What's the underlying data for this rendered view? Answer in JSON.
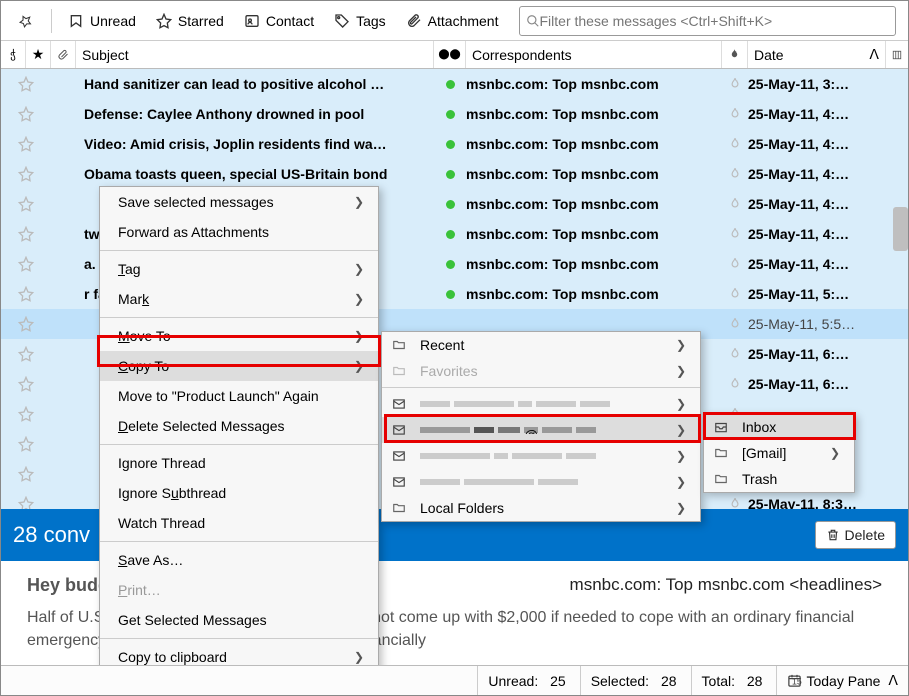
{
  "toolbar": {
    "unread": "Unread",
    "starred": "Starred",
    "contact": "Contact",
    "tags": "Tags",
    "attachment": "Attachment",
    "search_placeholder": "Filter these messages <Ctrl+Shift+K>"
  },
  "columns": {
    "subject": "Subject",
    "correspondents": "Correspondents",
    "date": "Date"
  },
  "rows": [
    {
      "subject": "Hand sanitizer can lead to positive alcohol …",
      "corr": "msnbc.com: Top msnbc.com",
      "date": "25-May-11, 3:…",
      "bold": true,
      "dot": true
    },
    {
      "subject": "Defense: Caylee Anthony drowned in pool",
      "corr": "msnbc.com: Top msnbc.com",
      "date": "25-May-11, 4:…",
      "bold": true,
      "dot": true
    },
    {
      "subject": "Video: Amid crisis, Joplin residents find wa…",
      "corr": "msnbc.com: Top msnbc.com",
      "date": "25-May-11, 4:…",
      "bold": true,
      "dot": true
    },
    {
      "subject": "Obama toasts queen, special US-Britain bond",
      "corr": "msnbc.com: Top msnbc.com",
      "date": "25-May-11, 4:…",
      "bold": true,
      "dot": true
    },
    {
      "subject": "",
      "corr": "msnbc.com: Top msnbc.com",
      "date": "25-May-11, 4:…",
      "bold": true,
      "dot": true
    },
    {
      "subject": "twi…",
      "corr": "msnbc.com: Top msnbc.com",
      "date": "25-May-11, 4:…",
      "bold": true,
      "dot": true
    },
    {
      "subject": "a. C…",
      "corr": "msnbc.com: Top msnbc.com",
      "date": "25-May-11, 4:…",
      "bold": true,
      "dot": true
    },
    {
      "subject": "r fa…",
      "corr": "msnbc.com: Top msnbc.com",
      "date": "25-May-11, 5:…",
      "bold": true,
      "dot": true
    },
    {
      "subject": "",
      "corr": "",
      "date": "25-May-11, 5:5…",
      "bold": false,
      "dot": false,
      "sel": true
    },
    {
      "subject": "",
      "corr": "",
      "date": "25-May-11, 6:…",
      "bold": true,
      "dot": false
    },
    {
      "subject": "",
      "corr": "",
      "date": "25-May-11, 6:…",
      "bold": true,
      "dot": false
    },
    {
      "subject": "",
      "corr": "",
      "date": "",
      "bold": true,
      "dot": false
    },
    {
      "subject": "",
      "corr": "",
      "date": "",
      "bold": true,
      "dot": false
    },
    {
      "subject": "",
      "corr": "",
      "date": "",
      "bold": true,
      "dot": false
    },
    {
      "subject": "",
      "corr": "",
      "date": "25-May-11, 8:3…",
      "bold": true,
      "dot": false
    }
  ],
  "context_menu": {
    "save_selected": "Save selected messages",
    "forward": "Forward as Attachments",
    "tag": "Tag",
    "mark": "Mark",
    "move_to": "Move To",
    "copy_to": "Copy To",
    "move_again": "Move to \"Product Launch\" Again",
    "delete_sel": "Delete Selected Messages",
    "ignore_thread": "Ignore Thread",
    "ignore_sub": "Ignore Subthread",
    "watch": "Watch Thread",
    "save_as": "Save As…",
    "print": "Print…",
    "get_sel": "Get Selected Messages",
    "copy_clip": "Copy to clipboard"
  },
  "submenu1": {
    "recent": "Recent",
    "favorites": "Favorites",
    "local": "Local Folders"
  },
  "submenu2": {
    "inbox": "Inbox",
    "gmail": "[Gmail]",
    "trash": "Trash"
  },
  "bar": {
    "title": "28 conv",
    "delete": "Delete"
  },
  "preview": {
    "greet": "Hey buddy, can you spare $2,000?",
    "from": "msnbc.com: Top msnbc.com <headlines>",
    "body": "Half of U.S. households say they probably could not come up with $2,000 if needed to cope with an ordinary financial emergency, according to a study that shows a financially"
  },
  "status": {
    "unread_lbl": "Unread:",
    "unread_v": "25",
    "sel_lbl": "Selected:",
    "sel_v": "28",
    "total_lbl": "Total:",
    "total_v": "28",
    "today": "Today Pane"
  }
}
